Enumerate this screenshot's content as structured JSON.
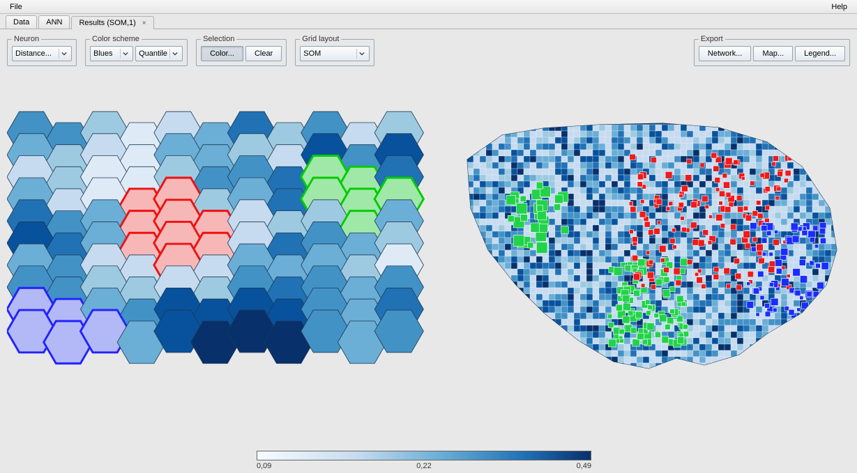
{
  "menubar": {
    "file": "File",
    "help": "Help"
  },
  "tabs": [
    {
      "label": "Data",
      "closable": false
    },
    {
      "label": "ANN",
      "closable": false
    },
    {
      "label": "Results (SOM,1)",
      "closable": true
    }
  ],
  "toolbar": {
    "neuron": {
      "legend": "Neuron",
      "value": "Distance..."
    },
    "colorScheme": {
      "legend": "Color scheme",
      "ramp": "Blues",
      "classify": "Quantile"
    },
    "selection": {
      "legend": "Selection",
      "colorBtn": "Color...",
      "clearBtn": "Clear"
    },
    "gridLayout": {
      "legend": "Grid layout",
      "value": "SOM"
    },
    "export": {
      "legend": "Export",
      "networkBtn": "Network...",
      "mapBtn": "Map...",
      "legendBtn": "Legend..."
    }
  },
  "legend": {
    "min": "0,09",
    "mid": "0,22",
    "max": "0,49"
  },
  "hexgrid": {
    "cols": 11,
    "rows": 10,
    "palette": [
      "#f7fbff",
      "#deebf7",
      "#c6dbef",
      "#9ecae1",
      "#6baed6",
      "#4292c6",
      "#2171b5",
      "#08519c",
      "#08306b"
    ],
    "cells": [
      [
        5,
        5,
        3,
        1,
        2,
        4,
        6,
        3,
        5,
        2,
        3
      ],
      [
        4,
        3,
        2,
        1,
        4,
        4,
        3,
        2,
        7,
        5,
        7
      ],
      [
        2,
        3,
        1,
        1,
        3,
        5,
        5,
        6,
        5,
        4,
        6
      ],
      [
        4,
        2,
        1,
        2,
        2,
        3,
        4,
        6,
        5,
        4,
        5
      ],
      [
        6,
        5,
        4,
        1,
        2,
        1,
        2,
        3,
        3,
        3,
        4
      ],
      [
        7,
        6,
        4,
        1,
        1,
        1,
        2,
        6,
        5,
        4,
        3
      ],
      [
        4,
        5,
        2,
        2,
        1,
        2,
        4,
        4,
        4,
        3,
        1
      ],
      [
        5,
        5,
        3,
        3,
        2,
        3,
        5,
        6,
        5,
        4,
        5
      ],
      [
        4,
        4,
        4,
        5,
        7,
        7,
        7,
        7,
        5,
        4,
        6
      ],
      [
        5,
        4,
        1,
        4,
        7,
        8,
        8,
        8,
        5,
        4,
        5
      ]
    ],
    "selections": {
      "red": [
        [
          3,
          3
        ],
        [
          3,
          4
        ],
        [
          4,
          3
        ],
        [
          4,
          4
        ],
        [
          4,
          5
        ],
        [
          5,
          3
        ],
        [
          5,
          4
        ],
        [
          5,
          5
        ],
        [
          6,
          4
        ]
      ],
      "green": [
        [
          2,
          8
        ],
        [
          2,
          9
        ],
        [
          3,
          8
        ],
        [
          3,
          9
        ],
        [
          3,
          10
        ],
        [
          4,
          9
        ]
      ],
      "blue": [
        [
          8,
          0
        ],
        [
          8,
          1
        ],
        [
          9,
          0
        ],
        [
          9,
          1
        ],
        [
          9,
          2
        ]
      ]
    }
  },
  "map": {
    "description": "US counties choropleth with red/green/blue selection overlays"
  }
}
